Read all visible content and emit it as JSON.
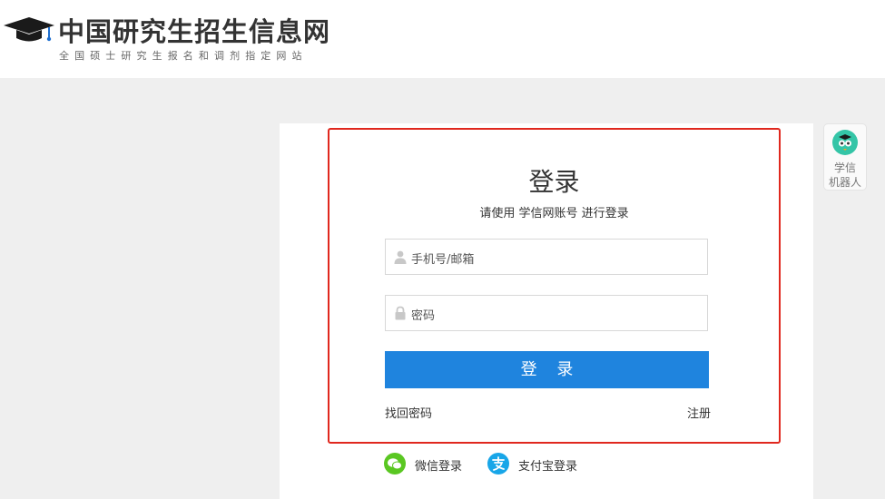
{
  "header": {
    "title": "中国研究生招生信息网",
    "subtitle": "全国硕士研究生报名和调剂指定网站",
    "logo_icon": "graduation-cap-icon"
  },
  "login": {
    "title": "登录",
    "description": "请使用 学信网账号 进行登录",
    "username_placeholder": "手机号/邮箱",
    "password_placeholder": "密码",
    "submit_label": "登 录",
    "forgot_password": "找回密码",
    "register": "注册"
  },
  "social": {
    "wechat_label": "微信登录",
    "alipay_label": "支付宝登录",
    "wechat_color": "#5ac722",
    "alipay_color": "#18a6e8"
  },
  "robot": {
    "line1": "学信",
    "line2": "机器人"
  },
  "colors": {
    "accent_blue": "#1f84de",
    "highlight_border": "#e0281e",
    "background": "#efefef"
  }
}
